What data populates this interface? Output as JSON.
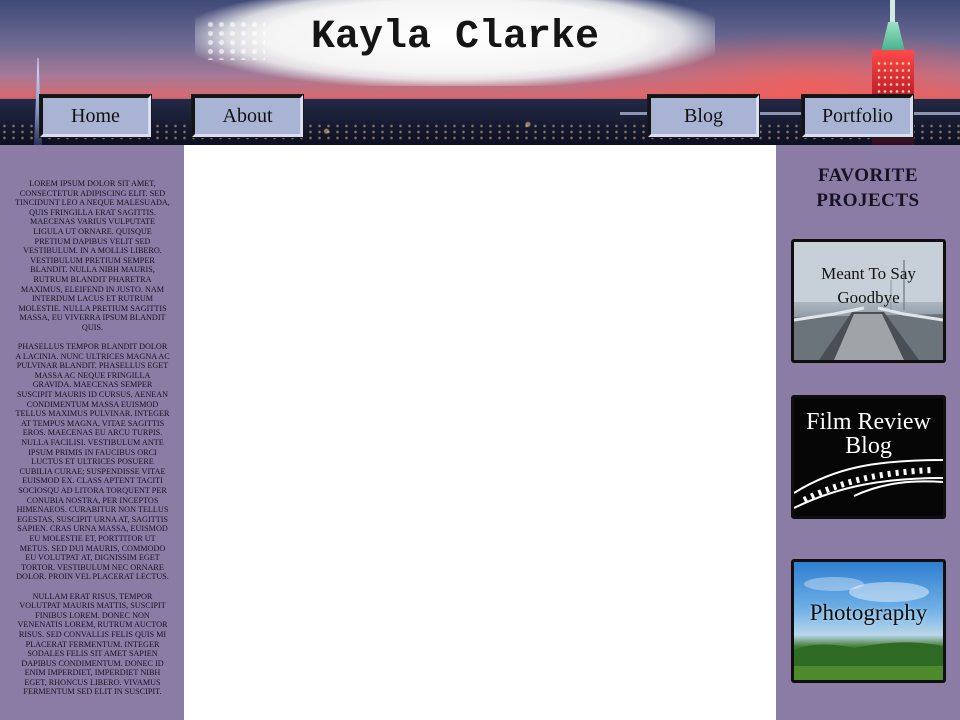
{
  "header": {
    "site_title": "Kayla Clarke",
    "nav": {
      "home": "Home",
      "about": "About",
      "blog": "Blog",
      "portfolio": "Portfolio"
    }
  },
  "left_sidebar": {
    "paragraphs": [
      "Lorem ipsum dolor sit amet, consectetur adipiscing elit. Sed tincidunt leo a neque malesuada, quis fringilla erat sagittis. Maecenas varius vulputate ligula ut ornare. Quisque pretium dapibus velit sed vestibulum. In a mollis libero. Vestibulum pretium semper blandit. Nulla nibh mauris, rutrum blandit pharetra maximus, eleifend in justo. Nam interdum lacus et rutrum molestie. Nulla pretium sagittis massa, eu viverra ipsum blandit quis.",
      "Phasellus tempor blandit dolor a lacinia. Nunc ultrices magna ac pulvinar blandit. Phasellus eget massa ac neque fringilla gravida. Maecenas semper suscipit mauris id cursus. Aenean condimentum massa euismod tellus maximus pulvinar. Integer at tempus magna, vitae sagittis eros. Maecenas eu arcu turpis. Nulla facilisi. Vestibulum ante ipsum primis in faucibus orci luctus et ultrices posuere cubilia curae; Suspendisse vitae euismod ex. Class aptent taciti sociosqu ad litora torquent per conubia nostra, per inceptos himenaeos. Curabitur non tellus egestas, suscipit urna at, sagittis sapien. Cras urna massa, euismod eu molestie et, porttitor ut metus. Sed dui mauris, commodo eu volutpat at, dignissim eget tortor. Vestibulum nec ornare dolor. Proin vel placerat lectus.",
      "Nullam erat risus, tempor volutpat mauris mattis, suscipit finibus lorem. Donec non venenatis lorem, rutrum auctor risus. Sed convallis felis quis mi placerat fermentum. Integer sodales felis sit amet sapien dapibus condimentum. Donec id enim imperdiet, imperdiet nibh eget, rhoncus libero. Vivamus fermentum sed elit in suscipit."
    ]
  },
  "right_sidebar": {
    "heading": "FAVORITE PROJECTS",
    "projects": [
      {
        "title": "Meant To Say Goodbye",
        "image": "snowy-bridge-photo"
      },
      {
        "title": "Film Review Blog",
        "image": "film-strip-graphic"
      },
      {
        "title": "Photography",
        "image": "sky-and-trees-photo"
      }
    ]
  },
  "colors": {
    "sidebar_bg": "#8b7ca6",
    "nav_button_bg": "#a9b4d5",
    "content_bg": "#ffffff"
  }
}
